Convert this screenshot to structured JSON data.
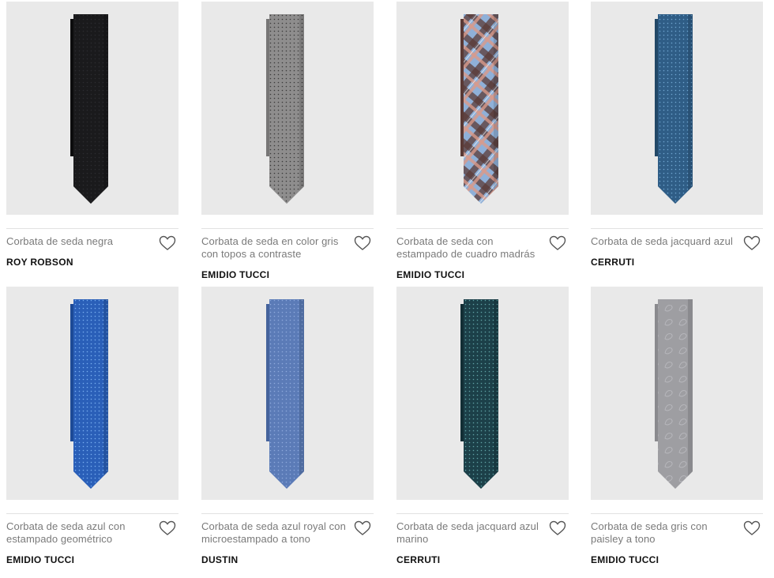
{
  "products": [
    {
      "title": "Corbata de seda negra",
      "brand": "ROY ROBSON",
      "tie": {
        "main": "#1a1a1c",
        "dark": "#0c0c0d",
        "pattern": "dots",
        "pc": "#2c2c30"
      }
    },
    {
      "title": "Corbata de seda en color gris con topos a contraste",
      "brand": "EMIDIO TUCCI",
      "tie": {
        "main": "#8e8d8d",
        "dark": "#777676",
        "pattern": "dots",
        "pc": "#3a3a3a"
      }
    },
    {
      "title": "Corbata de seda con estampado de cuadro madrás",
      "brand": "EMIDIO TUCCI",
      "tie": {
        "main": "#8fb0d8",
        "dark": "#5a3a36",
        "pattern": "plaid",
        "pc": "#d99a8a"
      }
    },
    {
      "title": "Corbata de seda jacquard azul",
      "brand": "CERRUTI",
      "tie": {
        "main": "#2f5d86",
        "dark": "#234867",
        "pattern": "dots",
        "pc": "#6fa4cf"
      }
    },
    {
      "title": "Corbata de seda azul con estampado geométrico",
      "brand": "EMIDIO TUCCI",
      "tie": {
        "main": "#2a5fb8",
        "dark": "#1d4a96",
        "pattern": "dots",
        "pc": "#78aef0"
      }
    },
    {
      "title": "Corbata de seda azul royal con microestampado a tono",
      "brand": "DUSTIN",
      "tie": {
        "main": "#5b7bb7",
        "dark": "#45639c",
        "pattern": "dots",
        "pc": "#8ea9dc"
      }
    },
    {
      "title": "Corbata de seda jacquard azul marino",
      "brand": "CERRUTI",
      "tie": {
        "main": "#1c4049",
        "dark": "#122e35",
        "pattern": "dots",
        "pc": "#5fa2a5"
      }
    },
    {
      "title": "Corbata de seda gris con paisley a tono",
      "brand": "EMIDIO TUCCI",
      "tie": {
        "main": "#9e9ea2",
        "dark": "#8a8a8e",
        "pattern": "paisley",
        "pc": "#b8b8bd"
      }
    }
  ],
  "icons": {
    "favorite": "heart-outline-icon"
  }
}
